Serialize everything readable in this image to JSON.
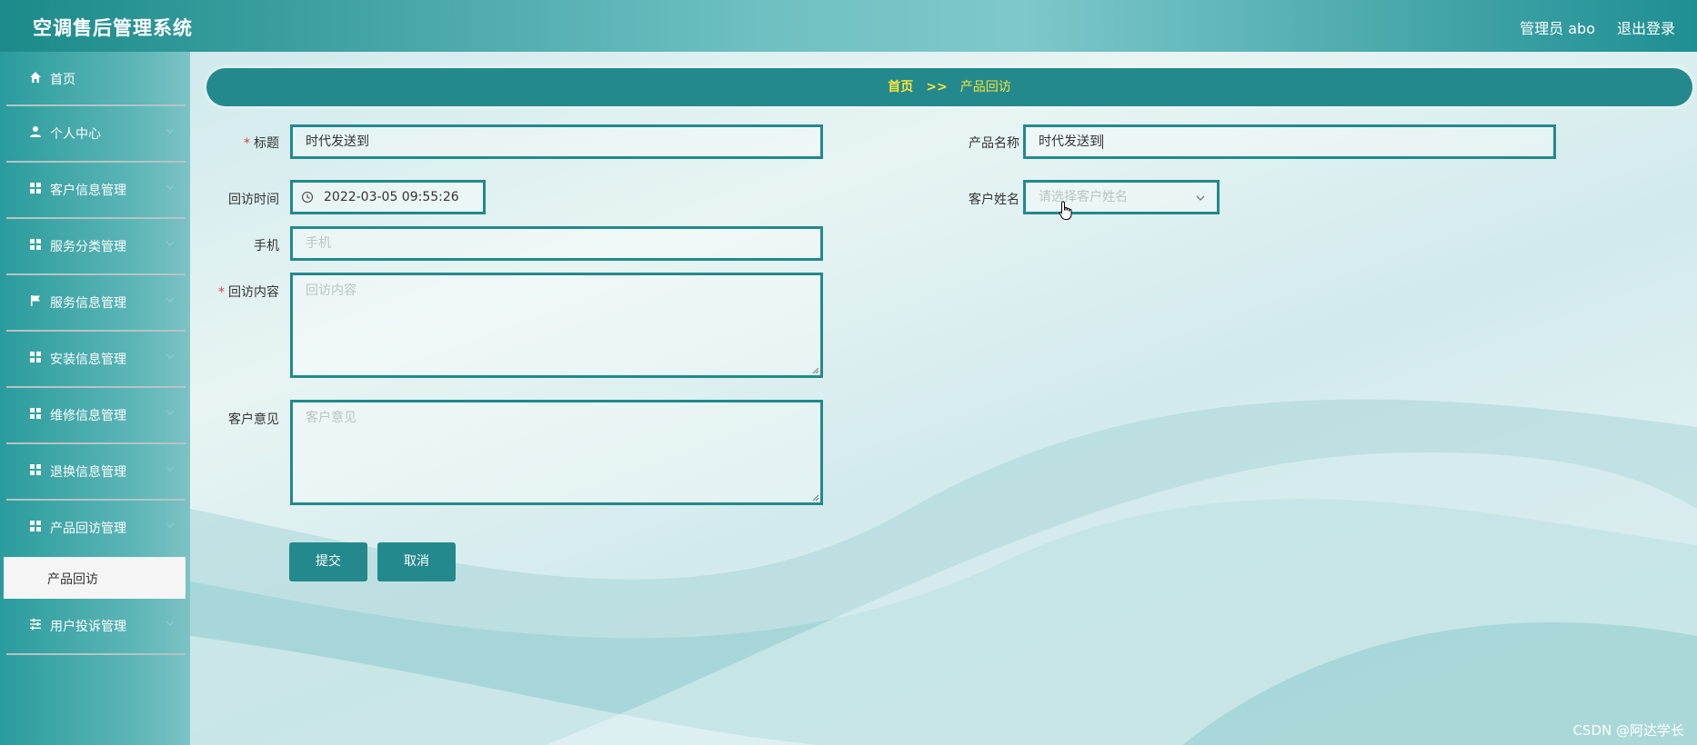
{
  "header": {
    "title": "空调售后管理系统",
    "user": "管理员 abo",
    "logout": "退出登录"
  },
  "sidebar": {
    "items": [
      {
        "label": "首页",
        "icon": "home-icon"
      },
      {
        "label": "个人中心",
        "icon": "user-icon"
      },
      {
        "label": "客户信息管理",
        "icon": "grid-icon"
      },
      {
        "label": "服务分类管理",
        "icon": "grid-icon"
      },
      {
        "label": "服务信息管理",
        "icon": "flag-icon"
      },
      {
        "label": "安装信息管理",
        "icon": "grid-icon"
      },
      {
        "label": "维修信息管理",
        "icon": "grid-icon"
      },
      {
        "label": "退换信息管理",
        "icon": "grid-icon"
      },
      {
        "label": "产品回访管理",
        "icon": "grid-icon"
      },
      {
        "label": "用户投诉管理",
        "icon": "sliders-icon"
      }
    ],
    "active_sub": "产品回访"
  },
  "breadcrumb": {
    "home": "首页",
    "sep": ">>",
    "current": "产品回访"
  },
  "form": {
    "title_label": "标题",
    "title_value": "时代发送到",
    "product_label": "产品名称",
    "product_value": "时代发送到",
    "time_label": "回访时间",
    "time_value": "2022-03-05 09:55:26",
    "customer_label": "客户姓名",
    "customer_placeholder": "请选择客户姓名",
    "phone_label": "手机",
    "phone_placeholder": "手机",
    "content_label": "回访内容",
    "content_placeholder": "回访内容",
    "opinion_label": "客户意见",
    "opinion_placeholder": "客户意见",
    "submit": "提交",
    "cancel": "取消"
  },
  "watermark": "CSDN @阿达学长",
  "colors": {
    "accent": "#23898c",
    "breadcrumb_text": "#f6e33b",
    "required": "#e04040"
  }
}
